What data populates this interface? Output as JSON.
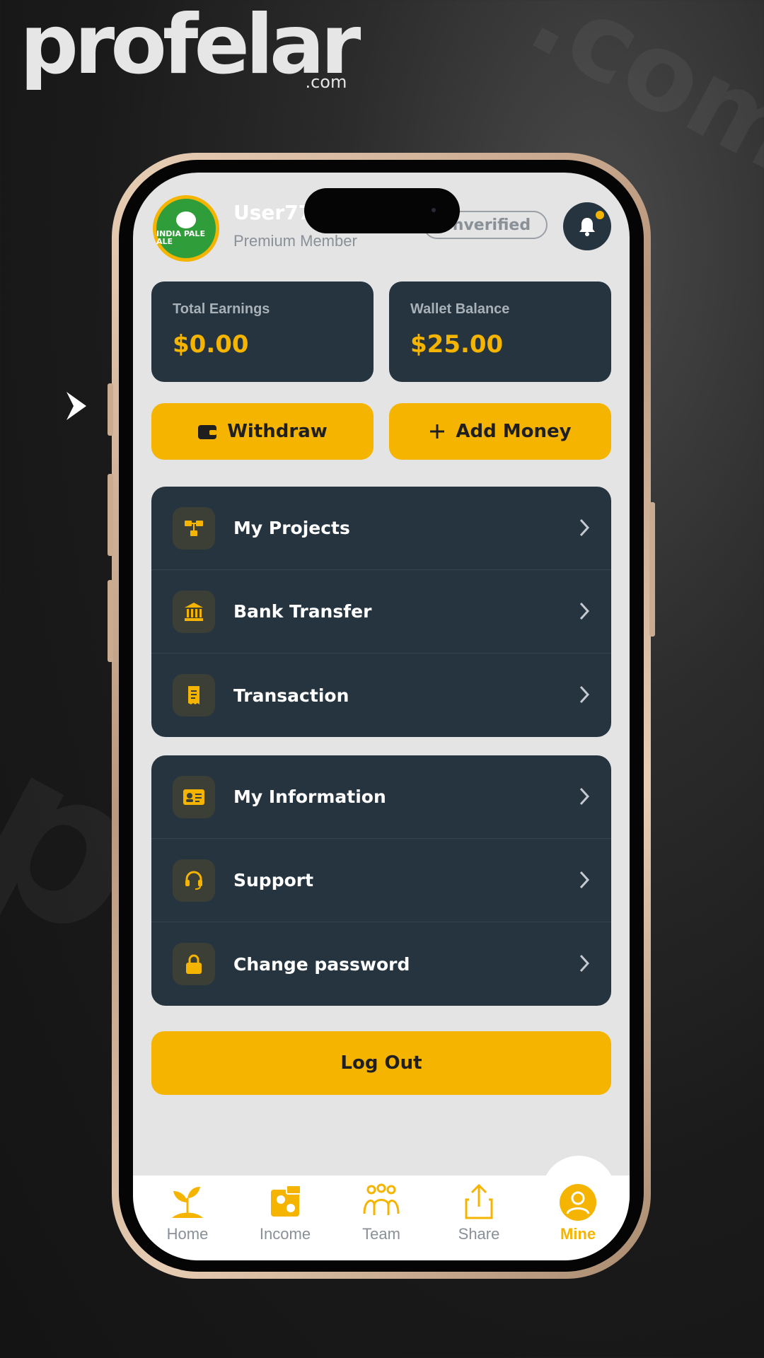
{
  "brand": {
    "name": "profelar",
    "suffix": ".com"
  },
  "header": {
    "username": "User77",
    "membership": "Premium Member",
    "status_badge": "Unverified",
    "avatar_text": "INDIA PALE ALE"
  },
  "cards": [
    {
      "label": "Total Earnings",
      "value": "$0.00"
    },
    {
      "label": "Wallet Balance",
      "value": "$25.00"
    }
  ],
  "actions": {
    "withdraw": "Withdraw",
    "add_money": "Add Money"
  },
  "menu_group_1": [
    {
      "label": "My Projects",
      "icon": "projects-icon"
    },
    {
      "label": "Bank Transfer",
      "icon": "bank-icon"
    },
    {
      "label": "Transaction",
      "icon": "receipt-icon"
    }
  ],
  "menu_group_2": [
    {
      "label": "My Information",
      "icon": "id-card-icon"
    },
    {
      "label": "Support",
      "icon": "headset-icon"
    },
    {
      "label": "Change password",
      "icon": "lock-icon"
    }
  ],
  "logout": "Log Out",
  "tabs": [
    {
      "label": "Home",
      "icon": "plant-icon",
      "active": false
    },
    {
      "label": "Income",
      "icon": "money-icon",
      "active": false
    },
    {
      "label": "Team",
      "icon": "team-icon",
      "active": false
    },
    {
      "label": "Share",
      "icon": "share-icon",
      "active": false
    },
    {
      "label": "Mine",
      "icon": "user-icon",
      "active": true
    }
  ],
  "colors": {
    "accent": "#f4b400",
    "card_bg": "#25343f",
    "screen_bg": "#e4e4e4"
  }
}
